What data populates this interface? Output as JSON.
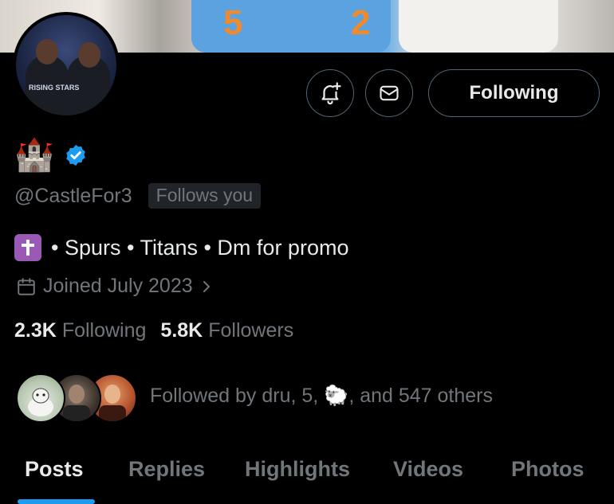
{
  "profile": {
    "display_name_emoji": "🏰",
    "handle": "@CastleFor3",
    "follows_you_badge": "Follows you",
    "bio_emoji": "✝",
    "bio_text": "• Spurs • Titans • Dm for promo",
    "joined": "Joined July 2023",
    "verified": true
  },
  "banner": {
    "jersey_number_left": "5",
    "jersey_number_right": "2"
  },
  "avatar": {
    "badge_text": "RISING STARS"
  },
  "actions": {
    "following_label": "Following"
  },
  "stats": {
    "following_count": "2.3K",
    "following_label": "Following",
    "followers_count": "5.8K",
    "followers_label": "Followers"
  },
  "followed_by": {
    "prefix": "Followed by dru, 5, ",
    "emoji": "🐑",
    "suffix": ", and 547 others"
  },
  "tabs": [
    {
      "label": "Posts",
      "active": true
    },
    {
      "label": "Replies",
      "active": false
    },
    {
      "label": "Highlights",
      "active": false
    },
    {
      "label": "Videos",
      "active": false
    },
    {
      "label": "Photos",
      "active": false
    }
  ],
  "colors": {
    "accent": "#1d9bf0",
    "background": "#000000",
    "primary_text": "#e7e9ea",
    "secondary_text": "#71767b",
    "border": "#536471"
  }
}
